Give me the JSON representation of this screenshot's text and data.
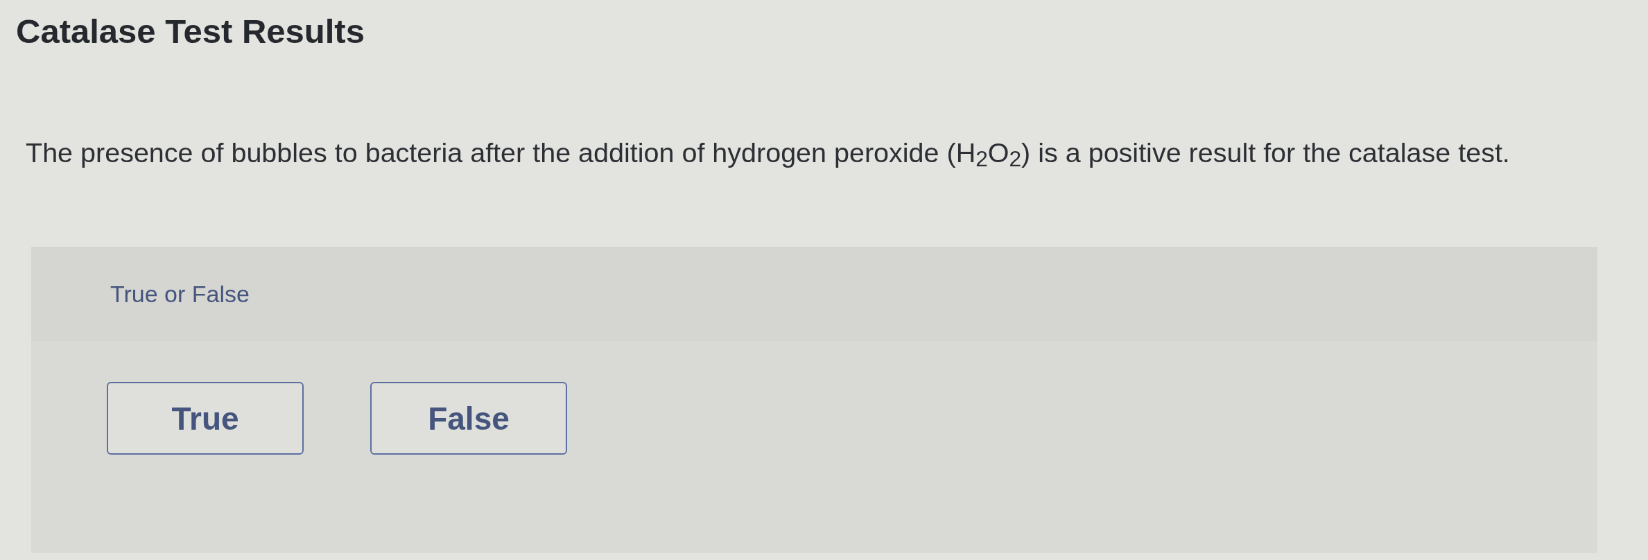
{
  "title": "Catalase Test Results",
  "question": {
    "text": "The presence of bubbles to bacteria after the addition of hydrogen peroxide (H$_{2}$O$_{2}$) is a positive result for the catalase test."
  },
  "answer_panel": {
    "prompt": "True or False",
    "options": [
      {
        "label": "True",
        "selected": false
      },
      {
        "label": "False",
        "selected": false
      }
    ]
  }
}
